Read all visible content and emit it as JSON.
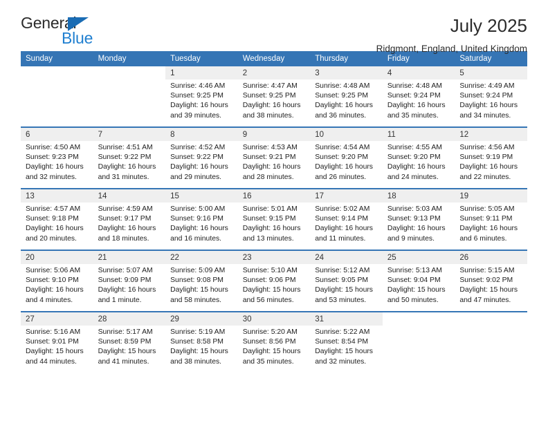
{
  "brand": {
    "name_part1": "General",
    "name_part2": "Blue",
    "triangle_icon": "triangle-icon"
  },
  "header": {
    "title": "July 2025",
    "location": "Ridgmont, England, United Kingdom"
  },
  "colors": {
    "header_blue": "#3575b5",
    "brand_blue": "#1f7fd0",
    "daynum_band": "#efefef",
    "text": "#222222"
  },
  "weekday_headers": [
    "Sunday",
    "Monday",
    "Tuesday",
    "Wednesday",
    "Thursday",
    "Friday",
    "Saturday"
  ],
  "labels": {
    "sunrise": "Sunrise:",
    "sunset": "Sunset:",
    "daylight": "Daylight:"
  },
  "weeks": [
    {
      "days": [
        {
          "num": "",
          "empty": true,
          "sunrise": "",
          "sunset": "",
          "daylight": ""
        },
        {
          "num": "",
          "empty": true,
          "sunrise": "",
          "sunset": "",
          "daylight": ""
        },
        {
          "num": "1",
          "empty": false,
          "sunrise": "Sunrise: 4:46 AM",
          "sunset": "Sunset: 9:25 PM",
          "daylight": "Daylight: 16 hours and 39 minutes."
        },
        {
          "num": "2",
          "empty": false,
          "sunrise": "Sunrise: 4:47 AM",
          "sunset": "Sunset: 9:25 PM",
          "daylight": "Daylight: 16 hours and 38 minutes."
        },
        {
          "num": "3",
          "empty": false,
          "sunrise": "Sunrise: 4:48 AM",
          "sunset": "Sunset: 9:25 PM",
          "daylight": "Daylight: 16 hours and 36 minutes."
        },
        {
          "num": "4",
          "empty": false,
          "sunrise": "Sunrise: 4:48 AM",
          "sunset": "Sunset: 9:24 PM",
          "daylight": "Daylight: 16 hours and 35 minutes."
        },
        {
          "num": "5",
          "empty": false,
          "sunrise": "Sunrise: 4:49 AM",
          "sunset": "Sunset: 9:24 PM",
          "daylight": "Daylight: 16 hours and 34 minutes."
        }
      ]
    },
    {
      "days": [
        {
          "num": "6",
          "empty": false,
          "sunrise": "Sunrise: 4:50 AM",
          "sunset": "Sunset: 9:23 PM",
          "daylight": "Daylight: 16 hours and 32 minutes."
        },
        {
          "num": "7",
          "empty": false,
          "sunrise": "Sunrise: 4:51 AM",
          "sunset": "Sunset: 9:22 PM",
          "daylight": "Daylight: 16 hours and 31 minutes."
        },
        {
          "num": "8",
          "empty": false,
          "sunrise": "Sunrise: 4:52 AM",
          "sunset": "Sunset: 9:22 PM",
          "daylight": "Daylight: 16 hours and 29 minutes."
        },
        {
          "num": "9",
          "empty": false,
          "sunrise": "Sunrise: 4:53 AM",
          "sunset": "Sunset: 9:21 PM",
          "daylight": "Daylight: 16 hours and 28 minutes."
        },
        {
          "num": "10",
          "empty": false,
          "sunrise": "Sunrise: 4:54 AM",
          "sunset": "Sunset: 9:20 PM",
          "daylight": "Daylight: 16 hours and 26 minutes."
        },
        {
          "num": "11",
          "empty": false,
          "sunrise": "Sunrise: 4:55 AM",
          "sunset": "Sunset: 9:20 PM",
          "daylight": "Daylight: 16 hours and 24 minutes."
        },
        {
          "num": "12",
          "empty": false,
          "sunrise": "Sunrise: 4:56 AM",
          "sunset": "Sunset: 9:19 PM",
          "daylight": "Daylight: 16 hours and 22 minutes."
        }
      ]
    },
    {
      "days": [
        {
          "num": "13",
          "empty": false,
          "sunrise": "Sunrise: 4:57 AM",
          "sunset": "Sunset: 9:18 PM",
          "daylight": "Daylight: 16 hours and 20 minutes."
        },
        {
          "num": "14",
          "empty": false,
          "sunrise": "Sunrise: 4:59 AM",
          "sunset": "Sunset: 9:17 PM",
          "daylight": "Daylight: 16 hours and 18 minutes."
        },
        {
          "num": "15",
          "empty": false,
          "sunrise": "Sunrise: 5:00 AM",
          "sunset": "Sunset: 9:16 PM",
          "daylight": "Daylight: 16 hours and 16 minutes."
        },
        {
          "num": "16",
          "empty": false,
          "sunrise": "Sunrise: 5:01 AM",
          "sunset": "Sunset: 9:15 PM",
          "daylight": "Daylight: 16 hours and 13 minutes."
        },
        {
          "num": "17",
          "empty": false,
          "sunrise": "Sunrise: 5:02 AM",
          "sunset": "Sunset: 9:14 PM",
          "daylight": "Daylight: 16 hours and 11 minutes."
        },
        {
          "num": "18",
          "empty": false,
          "sunrise": "Sunrise: 5:03 AM",
          "sunset": "Sunset: 9:13 PM",
          "daylight": "Daylight: 16 hours and 9 minutes."
        },
        {
          "num": "19",
          "empty": false,
          "sunrise": "Sunrise: 5:05 AM",
          "sunset": "Sunset: 9:11 PM",
          "daylight": "Daylight: 16 hours and 6 minutes."
        }
      ]
    },
    {
      "days": [
        {
          "num": "20",
          "empty": false,
          "sunrise": "Sunrise: 5:06 AM",
          "sunset": "Sunset: 9:10 PM",
          "daylight": "Daylight: 16 hours and 4 minutes."
        },
        {
          "num": "21",
          "empty": false,
          "sunrise": "Sunrise: 5:07 AM",
          "sunset": "Sunset: 9:09 PM",
          "daylight": "Daylight: 16 hours and 1 minute."
        },
        {
          "num": "22",
          "empty": false,
          "sunrise": "Sunrise: 5:09 AM",
          "sunset": "Sunset: 9:08 PM",
          "daylight": "Daylight: 15 hours and 58 minutes."
        },
        {
          "num": "23",
          "empty": false,
          "sunrise": "Sunrise: 5:10 AM",
          "sunset": "Sunset: 9:06 PM",
          "daylight": "Daylight: 15 hours and 56 minutes."
        },
        {
          "num": "24",
          "empty": false,
          "sunrise": "Sunrise: 5:12 AM",
          "sunset": "Sunset: 9:05 PM",
          "daylight": "Daylight: 15 hours and 53 minutes."
        },
        {
          "num": "25",
          "empty": false,
          "sunrise": "Sunrise: 5:13 AM",
          "sunset": "Sunset: 9:04 PM",
          "daylight": "Daylight: 15 hours and 50 minutes."
        },
        {
          "num": "26",
          "empty": false,
          "sunrise": "Sunrise: 5:15 AM",
          "sunset": "Sunset: 9:02 PM",
          "daylight": "Daylight: 15 hours and 47 minutes."
        }
      ]
    },
    {
      "days": [
        {
          "num": "27",
          "empty": false,
          "sunrise": "Sunrise: 5:16 AM",
          "sunset": "Sunset: 9:01 PM",
          "daylight": "Daylight: 15 hours and 44 minutes."
        },
        {
          "num": "28",
          "empty": false,
          "sunrise": "Sunrise: 5:17 AM",
          "sunset": "Sunset: 8:59 PM",
          "daylight": "Daylight: 15 hours and 41 minutes."
        },
        {
          "num": "29",
          "empty": false,
          "sunrise": "Sunrise: 5:19 AM",
          "sunset": "Sunset: 8:58 PM",
          "daylight": "Daylight: 15 hours and 38 minutes."
        },
        {
          "num": "30",
          "empty": false,
          "sunrise": "Sunrise: 5:20 AM",
          "sunset": "Sunset: 8:56 PM",
          "daylight": "Daylight: 15 hours and 35 minutes."
        },
        {
          "num": "31",
          "empty": false,
          "sunrise": "Sunrise: 5:22 AM",
          "sunset": "Sunset: 8:54 PM",
          "daylight": "Daylight: 15 hours and 32 minutes."
        },
        {
          "num": "",
          "empty": true,
          "sunrise": "",
          "sunset": "",
          "daylight": ""
        },
        {
          "num": "",
          "empty": true,
          "sunrise": "",
          "sunset": "",
          "daylight": ""
        }
      ]
    }
  ]
}
